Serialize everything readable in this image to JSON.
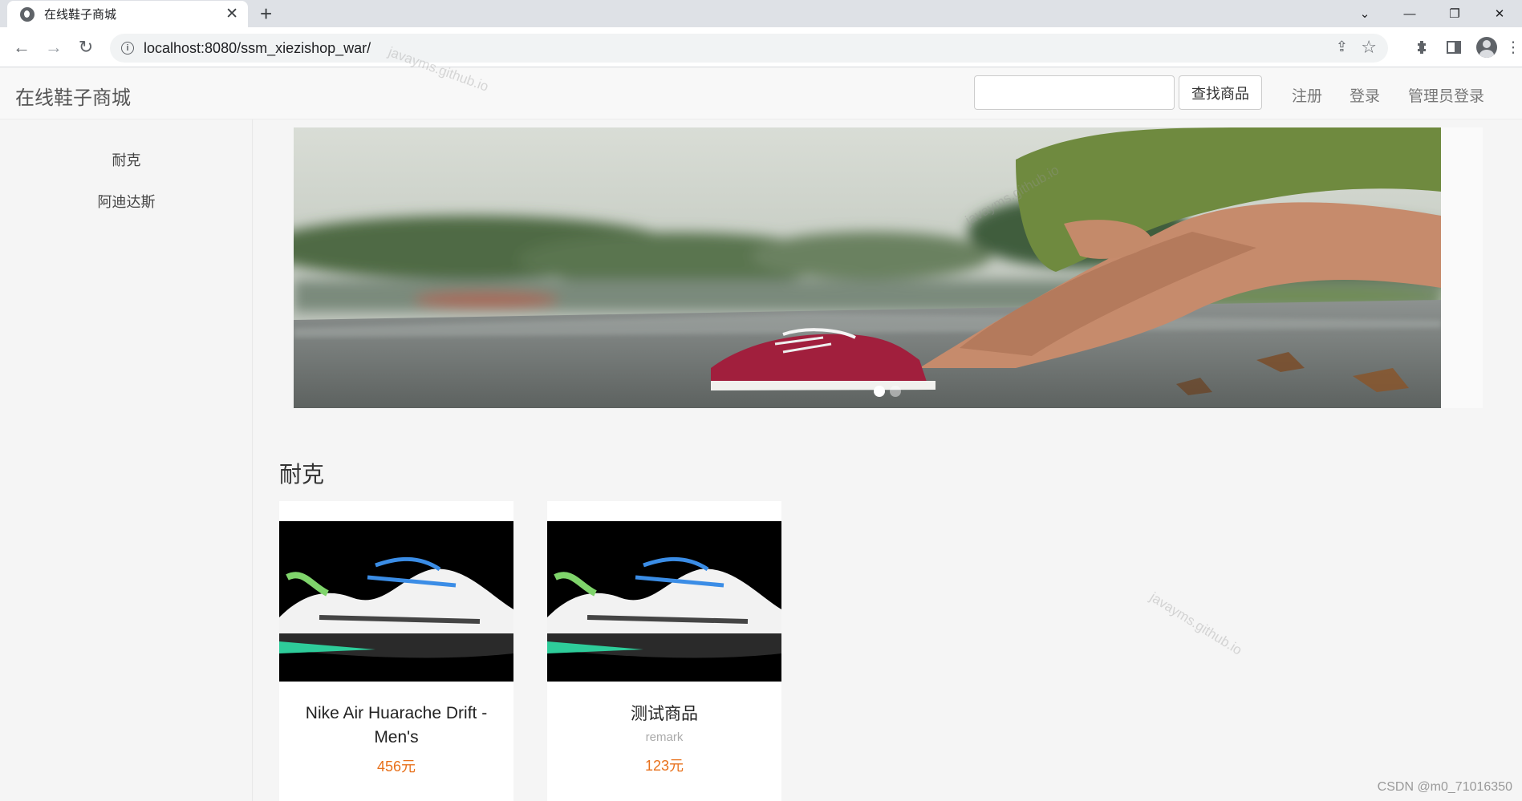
{
  "browser": {
    "tab_title": "在线鞋子商城",
    "tab_close": "✕",
    "new_tab": "+",
    "url": "localhost:8080/ssm_xiezishop_war/"
  },
  "header": {
    "brand": "在线鞋子商城",
    "search_placeholder": "",
    "search_button": "查找商品",
    "links": [
      "注册",
      "登录",
      "管理员登录"
    ]
  },
  "sidebar": {
    "items": [
      {
        "label": "耐克"
      },
      {
        "label": "阿迪达斯"
      }
    ]
  },
  "carousel": {
    "slide_count": 2,
    "active_index": 0
  },
  "section": {
    "title": "耐克",
    "products": [
      {
        "name": "Nike Air Huarache Drift - Men's",
        "remark": "",
        "price": "456元"
      },
      {
        "name": "测试商品",
        "remark": "remark",
        "price": "123元"
      }
    ]
  },
  "watermarks": {
    "text": "javayms.github.io",
    "credit": "CSDN @m0_71016350"
  },
  "colors": {
    "price": "#e8711c",
    "header_bg": "#f8f8f8",
    "page_bg": "#f5f5f5"
  }
}
